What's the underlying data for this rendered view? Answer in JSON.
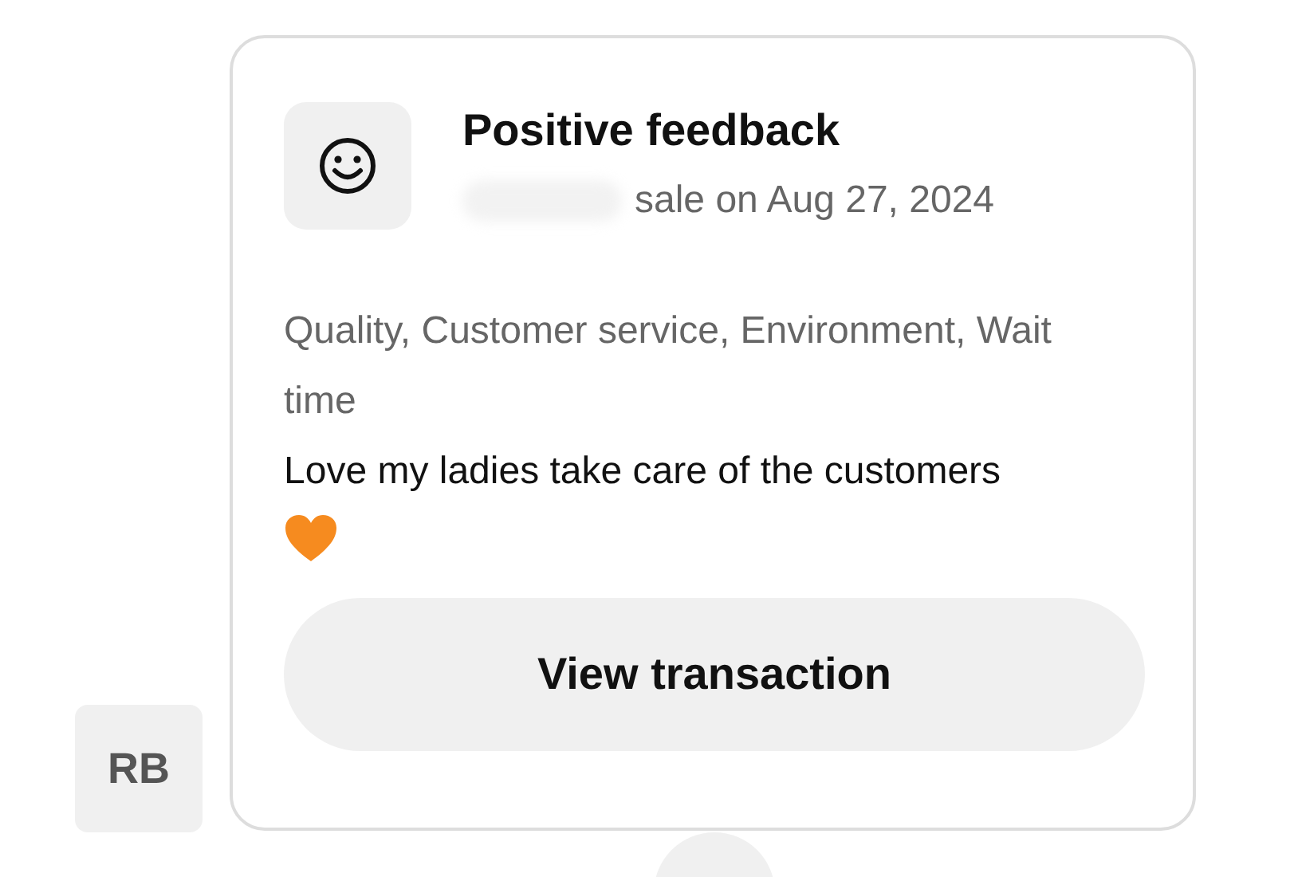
{
  "avatar": {
    "initials": "RB"
  },
  "feedback": {
    "title": "Positive feedback",
    "subtitle": "sale on Aug 27, 2024",
    "tags": "Quality, Customer service, Environment, Wait time",
    "comment": "Love my ladies take care of the customers",
    "button": "View transaction"
  }
}
